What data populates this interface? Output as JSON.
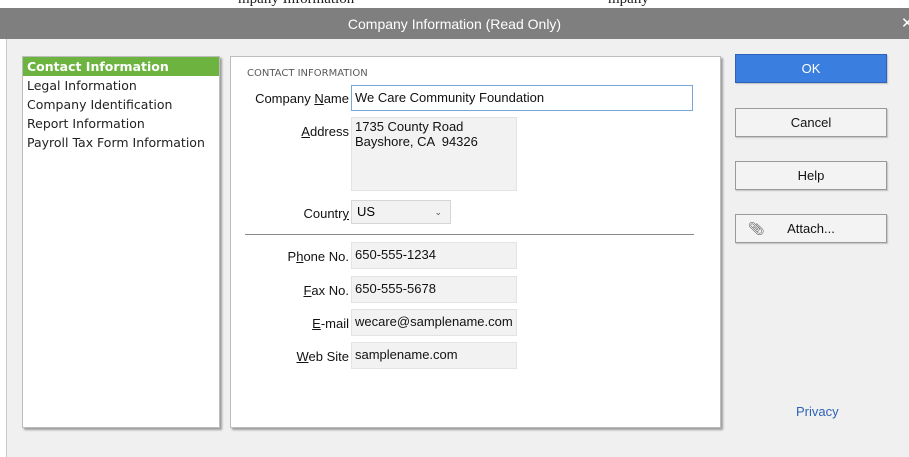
{
  "window": {
    "title": "Company Information (Read Only)"
  },
  "background_text": {
    "left": "mpany Information",
    "right": "mpany"
  },
  "nav": {
    "items": [
      {
        "label": "Contact Information",
        "active": true
      },
      {
        "label": "Legal Information",
        "active": false
      },
      {
        "label": "Company Identification",
        "active": false
      },
      {
        "label": "Report Information",
        "active": false
      },
      {
        "label": "Payroll Tax Form Information",
        "active": false
      }
    ]
  },
  "contact": {
    "heading": "CONTACT INFORMATION",
    "company_name_label_pre": "Company ",
    "company_name_label_key": "N",
    "company_name_label_post": "ame",
    "company_name": "We Care Community Foundation",
    "address_label_key": "A",
    "address_label_post": "ddress",
    "address_line1": "1735 County Road",
    "address_line2": "Bayshore, CA  94326",
    "country_label_pre": "Countr",
    "country_label_key": "y",
    "country": "US",
    "phone_label_pre": "P",
    "phone_label_key": "h",
    "phone_label_post": "one No.",
    "phone": "650-555-1234",
    "fax_label_key": "F",
    "fax_label_post": "ax No.",
    "fax": "650-555-5678",
    "email_label_key": "E",
    "email_label_post": "-mail",
    "email": "wecare@samplename.com",
    "website_label_key": "W",
    "website_label_post": "eb Site",
    "website": "samplename.com"
  },
  "buttons": {
    "ok": "OK",
    "cancel": "Cancel",
    "help": "Help",
    "attach": "Attach..."
  },
  "links": {
    "privacy": "Privacy"
  },
  "icons": {
    "attach": "paperclip-icon",
    "country_dropdown": "chevron-down-icon",
    "close": "close-icon"
  },
  "colors": {
    "active_nav": "#6cb33f",
    "primary_button": "#3a7ee0",
    "titlebar": "#7f7f7f",
    "link": "#2e63b5"
  }
}
